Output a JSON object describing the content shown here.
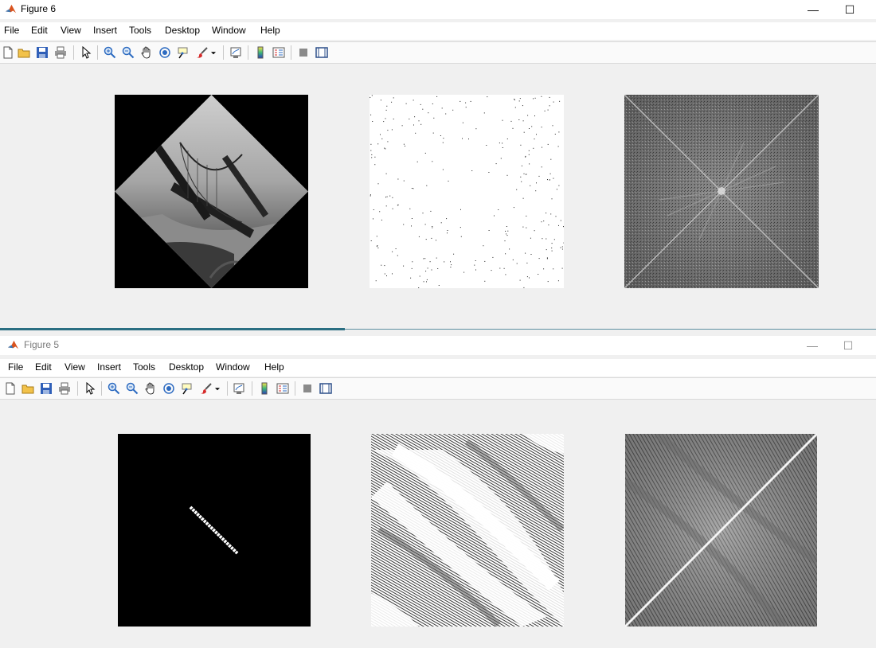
{
  "figure6": {
    "title": "Figure 6",
    "menu": [
      "File",
      "Edit",
      "View",
      "Insert",
      "Tools",
      "Desktop",
      "Window",
      "Help"
    ],
    "controls": {
      "minimize": "—",
      "maximize": "☐"
    }
  },
  "figure5": {
    "title": "Figure 5",
    "menu": [
      "File",
      "Edit",
      "View",
      "Insert",
      "Tools",
      "Desktop",
      "Window",
      "Help"
    ],
    "controls": {
      "minimize": "—",
      "maximize": "☐"
    }
  },
  "toolbar_icons": [
    "new-figure-icon",
    "open-file-icon",
    "save-icon",
    "print-icon",
    "pointer-icon",
    "zoom-in-icon",
    "zoom-out-icon",
    "pan-icon",
    "rotate-3d-icon",
    "data-cursor-icon",
    "brush-icon",
    "link-plot-icon",
    "colorbar-icon",
    "legend-icon",
    "hide-plot-tools-icon",
    "show-plot-tools-icon"
  ],
  "colors": {
    "window_bg": "#f0f0f0",
    "titlebar": "#ffffff",
    "matlab_icon": "#d9531e",
    "divider": "#2a6e82"
  }
}
